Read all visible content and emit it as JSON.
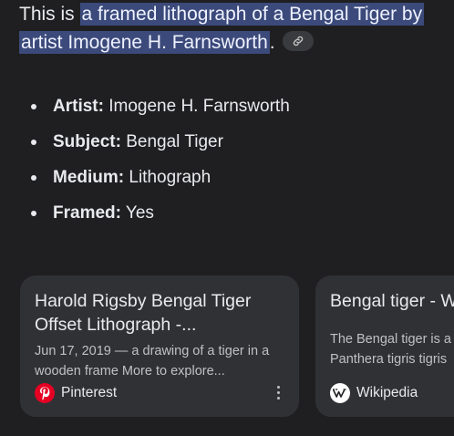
{
  "answer": {
    "prefix": "This is ",
    "highlight": "a framed lithograph of a Bengal Tiger by artist Imogene H. Farnsworth",
    "suffix": ".",
    "link_icon": "link-icon"
  },
  "facts": [
    {
      "key": "Artist:",
      "value": "Imogene H. Farnsworth"
    },
    {
      "key": "Subject:",
      "value": "Bengal Tiger"
    },
    {
      "key": "Medium:",
      "value": "Lithograph"
    },
    {
      "key": "Framed:",
      "value": "Yes"
    }
  ],
  "cards": [
    {
      "title": "Harold Rigsby Bengal Tiger Offset Lithograph -...",
      "snippet": "Jun 17, 2019 — a drawing of a tiger in a wooden frame More to explore...",
      "source": "Pinterest",
      "source_icon": "pinterest-logo-icon",
      "menu_icon": "more-vert-icon"
    },
    {
      "title": "Bengal tiger - W",
      "snippet_lines": [
        "The Bengal tiger is a",
        "Panthera tigris tigris"
      ],
      "source": "Wikipedia",
      "source_icon": "wikipedia-logo-icon"
    }
  ],
  "colors": {
    "background": "#1f1f21",
    "highlight": "#3b4a7a",
    "card": "#303134",
    "pinterest": "#e60023"
  }
}
